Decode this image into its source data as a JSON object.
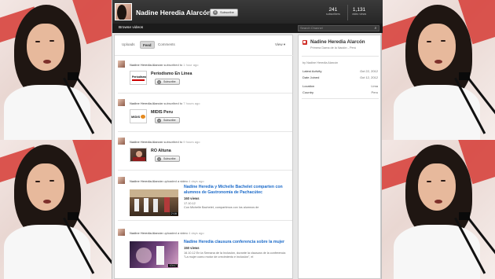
{
  "header": {
    "channel_name": "Nadine Heredia Alarcón",
    "subscribe_label": "Subscribe",
    "subscribers_count": "241",
    "subscribers_label": "subscribers",
    "views_count": "1,131",
    "views_label": "video views"
  },
  "navbar": {
    "browse_label": "Browse videos",
    "search_placeholder": "Search Channel"
  },
  "feed": {
    "tabs": [
      {
        "label": "Uploads"
      },
      {
        "label": "Feed"
      },
      {
        "label": "Comments"
      }
    ],
    "view_label": "View ▾",
    "items": [
      {
        "actor": "Nadine Heredia Alarcón",
        "action": "subscribed to",
        "time": "1 hour ago",
        "channel": "Periodismo En Línea",
        "subscribe_label": "Subscribe"
      },
      {
        "actor": "Nadine Heredia Alarcón",
        "action": "subscribed to",
        "time": "7 hours ago",
        "channel": "MIDIS Peru",
        "subscribe_label": "Subscribe"
      },
      {
        "actor": "Nadine Heredia Alarcón",
        "action": "subscribed to",
        "time": "9 hours ago",
        "channel": "RO Altuna",
        "subscribe_label": "Subscribe"
      },
      {
        "actor": "Nadine Heredia Alarcón",
        "action": "uploaded a video",
        "time": "4 days ago",
        "video_title": "Nadine Heredia y Michelle Bachelet comparten con alumnos de Gastronomía de Pachacútec",
        "views": "160 views",
        "date": "17.10.12",
        "desc": "Con Michelle Bachelet, compartimos con los alumnos de",
        "duration": "2:16"
      },
      {
        "actor": "Nadine Heredia Alarcón",
        "action": "uploaded a video",
        "time": "4 days ago",
        "video_title": "Nadine Heredia clausura conferencia sobre la mujer",
        "views": "150 views",
        "desc": "16.10.12 En la Semana de la Inclusión, durante la clausura de la conferencia \"La mujer como motor de crecimiento e inclusión\", el",
        "duration": "13:17"
      }
    ]
  },
  "sidebar": {
    "title": "Nadine Heredia Alarcón",
    "subtitle": "Primera Dama de la Nación - Perú",
    "byline": "by Nadine Heredia Alarcón",
    "rows": [
      {
        "label": "Latest Activity",
        "value": "Oct 22, 2012"
      },
      {
        "label": "Date Joined",
        "value": "Oct 12, 2012"
      },
      {
        "label": "Location",
        "value": "Lima"
      },
      {
        "label": "Country",
        "value": "Peru"
      }
    ]
  },
  "colors": {
    "header_bg": "#2e2e2e",
    "link_blue": "#1b6ac9",
    "brand_red": "#d0302a"
  }
}
